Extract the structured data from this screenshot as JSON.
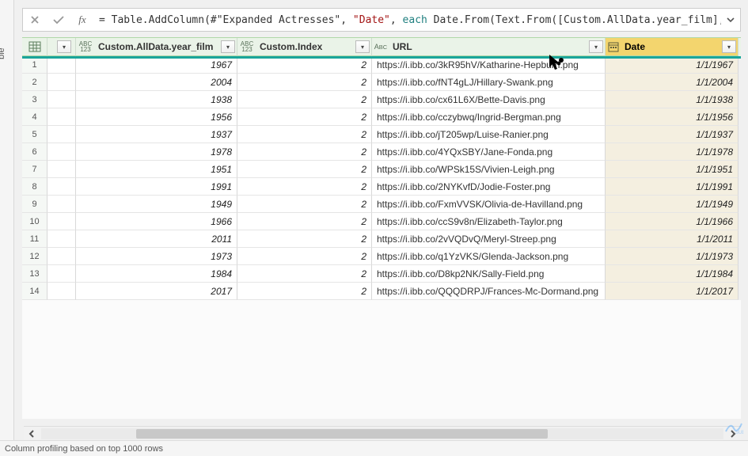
{
  "left_tab_label": "ble",
  "formula": {
    "prefix": "= ",
    "fn": "Table.AddColumn",
    "arg1_ref": "#\"Expanded Actresses\"",
    "arg2_str": "\"Date\"",
    "each_kw": "each",
    "rest": " Date.From(Text.From([Custom.AllData.year_film],"
  },
  "columns": {
    "year": "Custom.AllData.year_film",
    "index": "Custom.Index",
    "url": "URL",
    "date": "Date"
  },
  "type_badges": {
    "abc123_top": "ABC",
    "abc123_bot": "123",
    "abc_sub": "A",
    "abc_sup": "B",
    "abc_sub2": "C"
  },
  "rows": [
    {
      "n": 1,
      "year": "1967",
      "index": "2",
      "url": "https://i.ibb.co/3kR95hV/Katharine-Hepburn.png",
      "date": "1/1/1967"
    },
    {
      "n": 2,
      "year": "2004",
      "index": "2",
      "url": "https://i.ibb.co/fNT4gLJ/Hillary-Swank.png",
      "date": "1/1/2004"
    },
    {
      "n": 3,
      "year": "1938",
      "index": "2",
      "url": "https://i.ibb.co/cx61L6X/Bette-Davis.png",
      "date": "1/1/1938"
    },
    {
      "n": 4,
      "year": "1956",
      "index": "2",
      "url": "https://i.ibb.co/cczybwq/Ingrid-Bergman.png",
      "date": "1/1/1956"
    },
    {
      "n": 5,
      "year": "1937",
      "index": "2",
      "url": "https://i.ibb.co/jT205wp/Luise-Ranier.png",
      "date": "1/1/1937"
    },
    {
      "n": 6,
      "year": "1978",
      "index": "2",
      "url": "https://i.ibb.co/4YQxSBY/Jane-Fonda.png",
      "date": "1/1/1978"
    },
    {
      "n": 7,
      "year": "1951",
      "index": "2",
      "url": "https://i.ibb.co/WPSk15S/Vivien-Leigh.png",
      "date": "1/1/1951"
    },
    {
      "n": 8,
      "year": "1991",
      "index": "2",
      "url": "https://i.ibb.co/2NYKvfD/Jodie-Foster.png",
      "date": "1/1/1991"
    },
    {
      "n": 9,
      "year": "1949",
      "index": "2",
      "url": "https://i.ibb.co/FxmVVSK/Olivia-de-Havilland.png",
      "date": "1/1/1949"
    },
    {
      "n": 10,
      "year": "1966",
      "index": "2",
      "url": "https://i.ibb.co/ccS9v8n/Elizabeth-Taylor.png",
      "date": "1/1/1966"
    },
    {
      "n": 11,
      "year": "2011",
      "index": "2",
      "url": "https://i.ibb.co/2vVQDvQ/Meryl-Streep.png",
      "date": "1/1/2011"
    },
    {
      "n": 12,
      "year": "1973",
      "index": "2",
      "url": "https://i.ibb.co/q1YzVKS/Glenda-Jackson.png",
      "date": "1/1/1973"
    },
    {
      "n": 13,
      "year": "1984",
      "index": "2",
      "url": "https://i.ibb.co/D8kp2NK/Sally-Field.png",
      "date": "1/1/1984"
    },
    {
      "n": 14,
      "year": "2017",
      "index": "2",
      "url": "https://i.ibb.co/QQQDRPJ/Frances-Mc-Dormand.png",
      "date": "1/1/2017"
    }
  ],
  "status_text": "Column profiling based on top 1000 rows"
}
